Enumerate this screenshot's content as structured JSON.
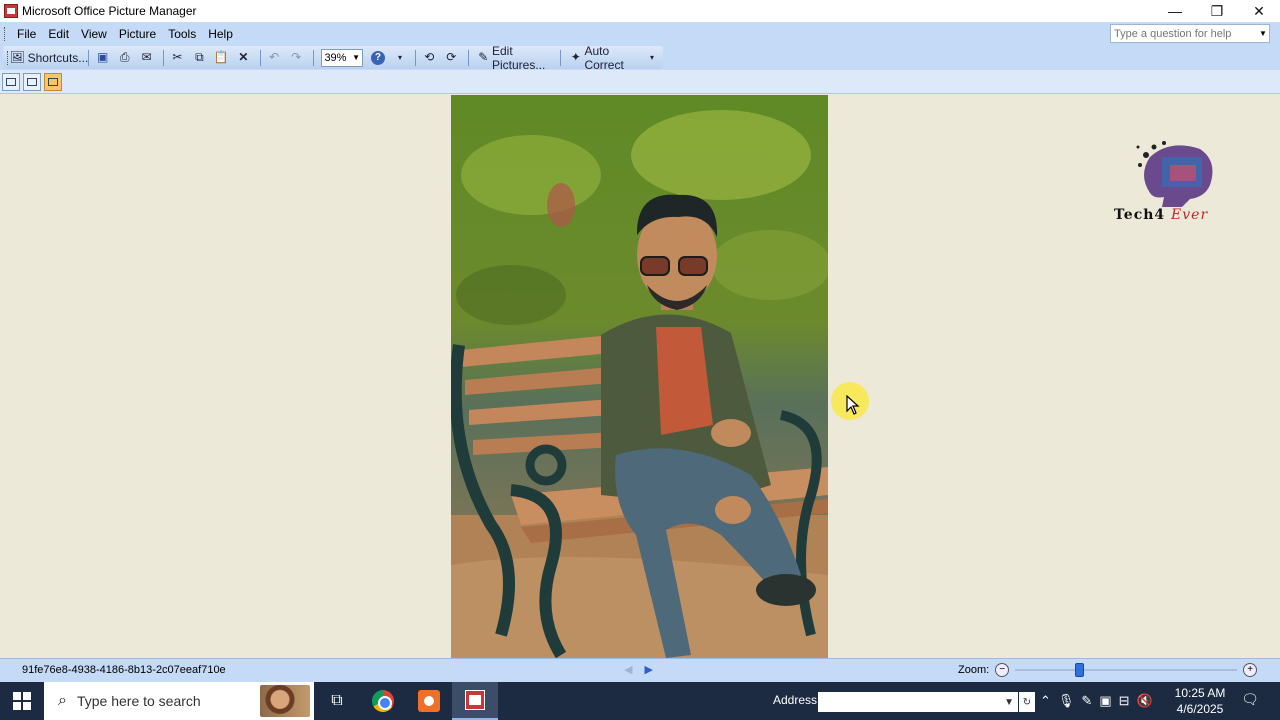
{
  "window": {
    "title": "Microsoft Office Picture Manager",
    "minimize": "—",
    "restore": "❐",
    "close": "✕"
  },
  "menu": {
    "items": [
      "File",
      "Edit",
      "View",
      "Picture",
      "Tools",
      "Help"
    ],
    "help_placeholder": "Type a question for help"
  },
  "toolbar": {
    "shortcuts_label": "Shortcuts...",
    "zoom_value": "39%",
    "edit_pictures_label": "Edit Pictures...",
    "auto_correct_label": "Auto Correct"
  },
  "watermark": {
    "brand_main": "Tech4",
    "brand_accent": "Ever"
  },
  "status": {
    "filename": "91fe76e8-4938-4186-8b13-2c07eeaf710e",
    "zoom_label": "Zoom:",
    "zoom_slider_fraction": 0.28
  },
  "taskbar": {
    "search_placeholder": "Type here to search",
    "address_label": "Address",
    "time": "10:25 AM",
    "date": "4/6/2025"
  },
  "colors": {
    "titlebar": "#ffffff",
    "menubar": "#c4daf6",
    "canvas": "#ece9d8",
    "taskbar": "#1c2b42",
    "cursor_highlight": "#fae846"
  }
}
